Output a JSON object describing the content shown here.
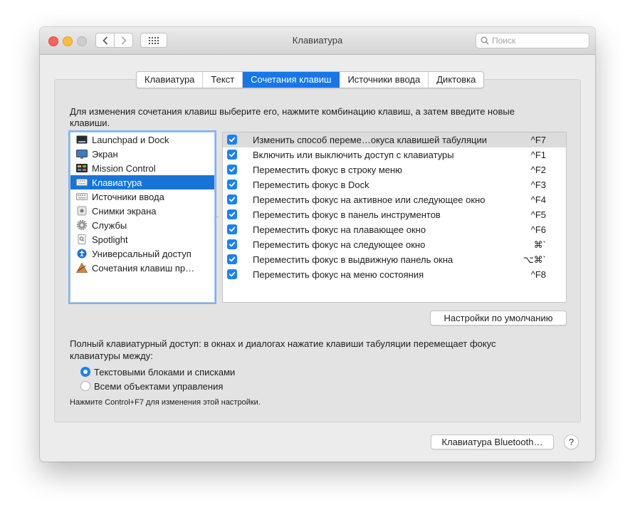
{
  "window": {
    "title": "Клавиатура"
  },
  "search": {
    "placeholder": "Поиск"
  },
  "tabs": [
    {
      "label": "Клавиатура",
      "active": false
    },
    {
      "label": "Текст",
      "active": false
    },
    {
      "label": "Сочетания клавиш",
      "active": true
    },
    {
      "label": "Источники ввода",
      "active": false
    },
    {
      "label": "Диктовка",
      "active": false
    }
  ],
  "instructions": "Для изменения сочетания клавиш выберите его, нажмите комбинацию клавиш, а затем введите новые клавиши.",
  "categories": [
    {
      "label": "Launchpad и Dock",
      "icon": "launchpad-icon",
      "selected": false
    },
    {
      "label": "Экран",
      "icon": "display-icon",
      "selected": false
    },
    {
      "label": "Mission Control",
      "icon": "mission-control-icon",
      "selected": false
    },
    {
      "label": "Клавиатура",
      "icon": "keyboard-icon",
      "selected": true
    },
    {
      "label": "Источники ввода",
      "icon": "input-sources-icon",
      "selected": false
    },
    {
      "label": "Снимки экрана",
      "icon": "screenshot-icon",
      "selected": false
    },
    {
      "label": "Службы",
      "icon": "services-gear-icon",
      "selected": false
    },
    {
      "label": "Spotlight",
      "icon": "spotlight-icon",
      "selected": false
    },
    {
      "label": "Универсальный доступ",
      "icon": "accessibility-icon",
      "selected": false
    },
    {
      "label": "Сочетания клавиш пр…",
      "icon": "app-shortcuts-icon",
      "selected": false
    }
  ],
  "shortcuts": [
    {
      "label": "Изменить способ переме…окуса клавишей табуляции",
      "key": "^F7",
      "checked": true,
      "highlighted": true
    },
    {
      "label": "Включить или выключить доступ с клавиатуры",
      "key": "^F1",
      "checked": true,
      "highlighted": false
    },
    {
      "label": "Переместить фокус в строку меню",
      "key": "^F2",
      "checked": true,
      "highlighted": false
    },
    {
      "label": "Переместить фокус в Dock",
      "key": "^F3",
      "checked": true,
      "highlighted": false
    },
    {
      "label": "Переместить фокус на активное или следующее окно",
      "key": "^F4",
      "checked": true,
      "highlighted": false
    },
    {
      "label": "Переместить фокус в панель инструментов",
      "key": "^F5",
      "checked": true,
      "highlighted": false
    },
    {
      "label": "Переместить фокус на плавающее окно",
      "key": "^F6",
      "checked": true,
      "highlighted": false
    },
    {
      "label": "Переместить фокус на следующее окно",
      "key": "⌘`",
      "checked": true,
      "highlighted": false
    },
    {
      "label": "Переместить фокус в выдвижную панель окна",
      "key": "⌥⌘`",
      "checked": true,
      "highlighted": false
    },
    {
      "label": "Переместить фокус на меню состояния",
      "key": "^F8",
      "checked": true,
      "highlighted": false
    }
  ],
  "restore_defaults_label": "Настройки по умолчанию",
  "full_keyboard_access": {
    "text": "Полный клавиатурный доступ: в окнах и диалогах нажатие клавиши табуляции перемещает фокус клавиатуры между:",
    "options": [
      {
        "label": "Текстовыми блоками и списками",
        "selected": true
      },
      {
        "label": "Всеми объектами управления",
        "selected": false
      }
    ],
    "hint": "Нажмите Control+F7 для изменения этой настройки."
  },
  "bluetooth_button_label": "Клавиатура Bluetooth…",
  "help_button_label": "?",
  "colors": {
    "accent": "#1a82f7",
    "selection": "#1874d9"
  }
}
